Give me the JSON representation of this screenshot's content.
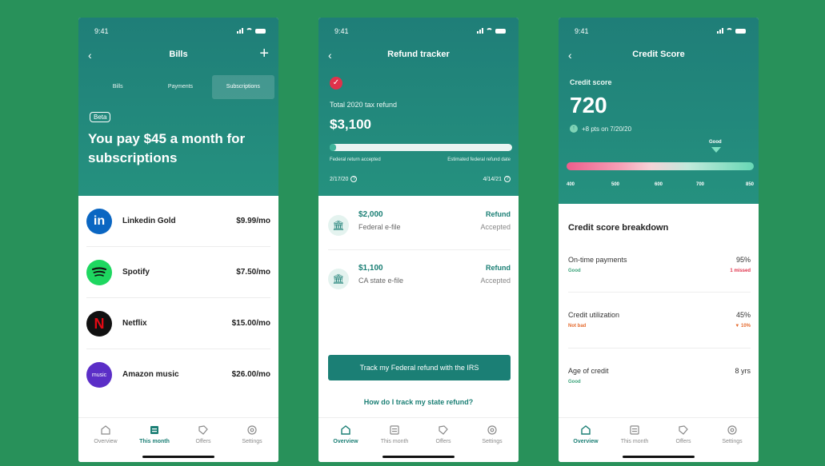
{
  "colors": {
    "background": "#28915a",
    "teal": "#1f7e78",
    "accent": "#1b7f75",
    "good": "#3aa37a",
    "warning": "#e56b2f",
    "bad": "#e0324b"
  },
  "status_bar": {
    "time": "9:41"
  },
  "tabs": [
    {
      "label": "Overview",
      "icon": "home-icon"
    },
    {
      "label": "This month",
      "icon": "calendar-icon"
    },
    {
      "label": "Offers",
      "icon": "tag-icon"
    },
    {
      "label": "Settings",
      "icon": "settings-icon"
    }
  ],
  "bills": {
    "title": "Bills",
    "segments": [
      "Bills",
      "Payments",
      "Subscriptions"
    ],
    "active_segment": "Subscriptions",
    "beta": "Beta",
    "headline": "You pay $45 a month for subscriptions",
    "subscriptions": [
      {
        "name": "Linkedin Gold",
        "price": "$9.99/mo",
        "logo_text": "in",
        "logo_color": "#0a66c2"
      },
      {
        "name": "Spotify",
        "price": "$7.50/mo",
        "logo_text": "",
        "logo_color": "#1ed760"
      },
      {
        "name": "Netflix",
        "price": "$15.00/mo",
        "logo_text": "N",
        "logo_color": "#111111"
      },
      {
        "name": "Amazon music",
        "price": "$26.00/mo",
        "logo_text": "music",
        "logo_color": "#5b2ec7"
      }
    ],
    "active_tab": "This month"
  },
  "refund": {
    "title": "Refund tracker",
    "total_label": "Total 2020 tax refund",
    "total_amount": "$3,100",
    "progress_fraction": 0.035,
    "left_label": "Federal return accepted",
    "left_date": "2/17/20",
    "right_label": "Estimated federal refund date",
    "right_date": "4/14/21",
    "filings": [
      {
        "amount": "$2,000",
        "name": "Federal e-file",
        "status": "Refund",
        "state": "Accepted"
      },
      {
        "amount": "$1,100",
        "name": "CA state e-file",
        "status": "Refund",
        "state": "Accepted"
      }
    ],
    "cta": "Track my Federal refund with the IRS",
    "link": "How do I track my state refund?",
    "active_tab": "Overview"
  },
  "credit": {
    "title": "Credit Score",
    "label": "Credit score",
    "score": "720",
    "change": "+8 pts on 7/20/20",
    "marker_label": "Good",
    "ticks": [
      "400",
      "500",
      "600",
      "700",
      "850"
    ],
    "breakdown_title": "Credit score breakdown",
    "factors": [
      {
        "name": "On-time payments",
        "value": "95%",
        "status": "Good",
        "detail": "1 missed",
        "status_color": "#3aa37a",
        "detail_color": "#e0324b"
      },
      {
        "name": "Credit utilization",
        "value": "45%",
        "status": "Not bad",
        "detail": "▼ 10%",
        "status_color": "#e56b2f",
        "detail_color": "#e56b2f"
      },
      {
        "name": "Age of credit",
        "value": "8 yrs",
        "status": "Good",
        "detail": "",
        "status_color": "#3aa37a",
        "detail_color": "#3aa37a"
      }
    ],
    "active_tab": "Overview"
  }
}
